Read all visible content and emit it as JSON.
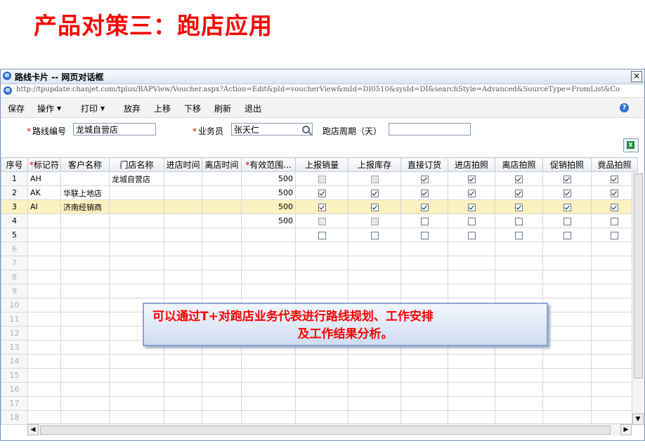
{
  "slide": {
    "title": "产品对策三：跑店应用"
  },
  "window": {
    "title": "路线卡片 -- 网页对话框",
    "close_glyph": "×",
    "url": "http://tpupdate.chanjet.com/tplus/BAPView/Voucher.aspx?Action=Edit&pId=voucherView&mId=DI0510&sysId=DI&searchStyle=Advanced&SourceType=FromList&Co"
  },
  "toolbar": {
    "items": [
      "保存",
      "操作",
      "打印",
      "放弃",
      "上移",
      "下移",
      "刷新",
      "退出"
    ],
    "dropdown_arrow": "▼"
  },
  "form": {
    "route_code_label": "路线编号",
    "route_code_value": "龙城自营店",
    "salesperson_label": "业务员",
    "salesperson_value": "张天仁",
    "cycle_label": "跑店周期（天）",
    "cycle_value": "",
    "required_mark": "*"
  },
  "grid": {
    "columns": [
      "序号",
      "标记符",
      "客户名称",
      "门店名称",
      "进店时间",
      "离店时间",
      "有效范围...",
      "上报销量",
      "上报库存",
      "直接订货",
      "进店拍照",
      "离店拍照",
      "促销拍照",
      "竟品拍照"
    ],
    "required_columns": [
      1,
      6
    ],
    "rows": [
      {
        "no": "1",
        "mark": "AH",
        "customer": "",
        "store": "龙城自营店",
        "in": "",
        "out": "",
        "range": "500",
        "checks": [
          0,
          0,
          1,
          1,
          1,
          1,
          1
        ],
        "disabled": [
          1,
          1,
          0,
          0,
          0,
          0,
          0
        ]
      },
      {
        "no": "2",
        "mark": "AK",
        "customer": "华联上地店",
        "store": "",
        "in": "",
        "out": "",
        "range": "500",
        "checks": [
          1,
          1,
          1,
          1,
          1,
          1,
          1
        ],
        "disabled": [
          0,
          0,
          0,
          0,
          0,
          0,
          0
        ]
      },
      {
        "no": "3",
        "mark": "AI",
        "customer": "济南经销商",
        "store": "",
        "in": "",
        "out": "",
        "range": "500",
        "checks": [
          1,
          1,
          1,
          1,
          1,
          1,
          1
        ],
        "disabled": [
          0,
          0,
          0,
          0,
          0,
          0,
          0
        ],
        "selected": true
      },
      {
        "no": "4",
        "mark": "",
        "customer": "",
        "store": "",
        "in": "",
        "out": "",
        "range": "500",
        "checks": [
          0,
          0,
          0,
          0,
          0,
          0,
          0
        ],
        "disabled": [
          1,
          1,
          0,
          0,
          0,
          0,
          0
        ]
      },
      {
        "no": "5",
        "mark": "",
        "customer": "",
        "store": "",
        "in": "",
        "out": "",
        "range": "",
        "checks": [
          0,
          0,
          0,
          0,
          0,
          0,
          0
        ],
        "disabled": [
          0,
          0,
          0,
          0,
          0,
          0,
          0
        ]
      }
    ],
    "empty_row_numbers": [
      "6",
      "7",
      "8",
      "9",
      "10",
      "11",
      "12",
      "13",
      "14",
      "15",
      "16",
      "17",
      "18"
    ]
  },
  "callout": {
    "line1": "可以通过T+对跑店业务代表进行路线规划、工作安排",
    "line2": "及工作结果分析。"
  },
  "scroll": {
    "left": "◀",
    "right": "▶",
    "up": "▲",
    "down": "▼"
  }
}
